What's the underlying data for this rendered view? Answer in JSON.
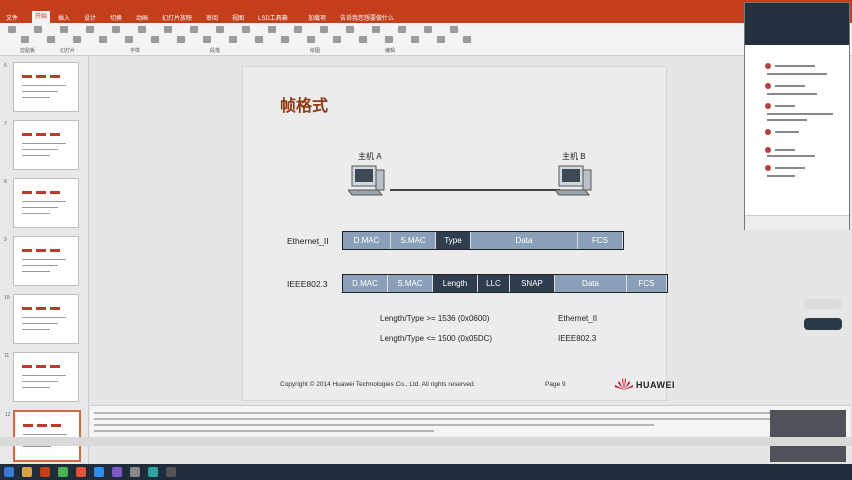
{
  "window": {
    "title": "",
    "menu_tabs": [
      "文件",
      "开始",
      "插入",
      "设计",
      "切换",
      "动画",
      "幻灯片放映",
      "审阅",
      "视图",
      "LSD工具箱",
      "加载项",
      "告诉我您想要做什么"
    ],
    "active_tab": 1,
    "ribbon_groups": [
      "剪贴板",
      "幻灯片",
      "字体",
      "段落",
      "绘图",
      "编辑"
    ]
  },
  "slide": {
    "title": "帧格式",
    "host_a": "主机 A",
    "host_b": "主机 B",
    "ethernet_label": "Ethernet_II",
    "ieee_label": "IEEE802.3",
    "ethernet_fields": [
      {
        "text": "D.MAC",
        "tone": "light",
        "w": 48
      },
      {
        "text": "S.MAC",
        "tone": "light",
        "w": 45
      },
      {
        "text": "Type",
        "tone": "mid",
        "w": 35
      },
      {
        "text": "Data",
        "tone": "light",
        "w": 107
      },
      {
        "text": "FCS",
        "tone": "light",
        "w": 45
      }
    ],
    "ieee_fields": [
      {
        "text": "D.MAC",
        "tone": "light",
        "w": 45
      },
      {
        "text": "S.MAC",
        "tone": "light",
        "w": 45
      },
      {
        "text": "Length",
        "tone": "mid",
        "w": 45
      },
      {
        "text": "LLC",
        "tone": "mid",
        "w": 32
      },
      {
        "text": "SNAP",
        "tone": "mid",
        "w": 45
      },
      {
        "text": "Data",
        "tone": "light",
        "w": 72
      },
      {
        "text": "FCS",
        "tone": "light",
        "w": 40
      }
    ],
    "rule1_text": "Length/Type >= 1536 (0x0600)",
    "rule1_result": "Ethernet_II",
    "rule2_text": "Length/Type <= 1500 (0x05DC)",
    "rule2_result": "IEEE802.3",
    "copyright": "Copyright © 2014 Huawei Technologies Co., Ltd. All rights reserved.",
    "page": "Page 9",
    "brand": "HUAWEI"
  },
  "thumbnails": [
    {
      "num": "6"
    },
    {
      "num": "7"
    },
    {
      "num": "8"
    },
    {
      "num": "9"
    },
    {
      "num": "10"
    },
    {
      "num": "11"
    },
    {
      "num": "12"
    }
  ],
  "selected_thumbnail": 6,
  "colors": {
    "title_bar": "#c43e1c",
    "frame_light": "#8aa0b8",
    "frame_dark": "#2e3e4e",
    "slide_title": "#8a3a14"
  }
}
